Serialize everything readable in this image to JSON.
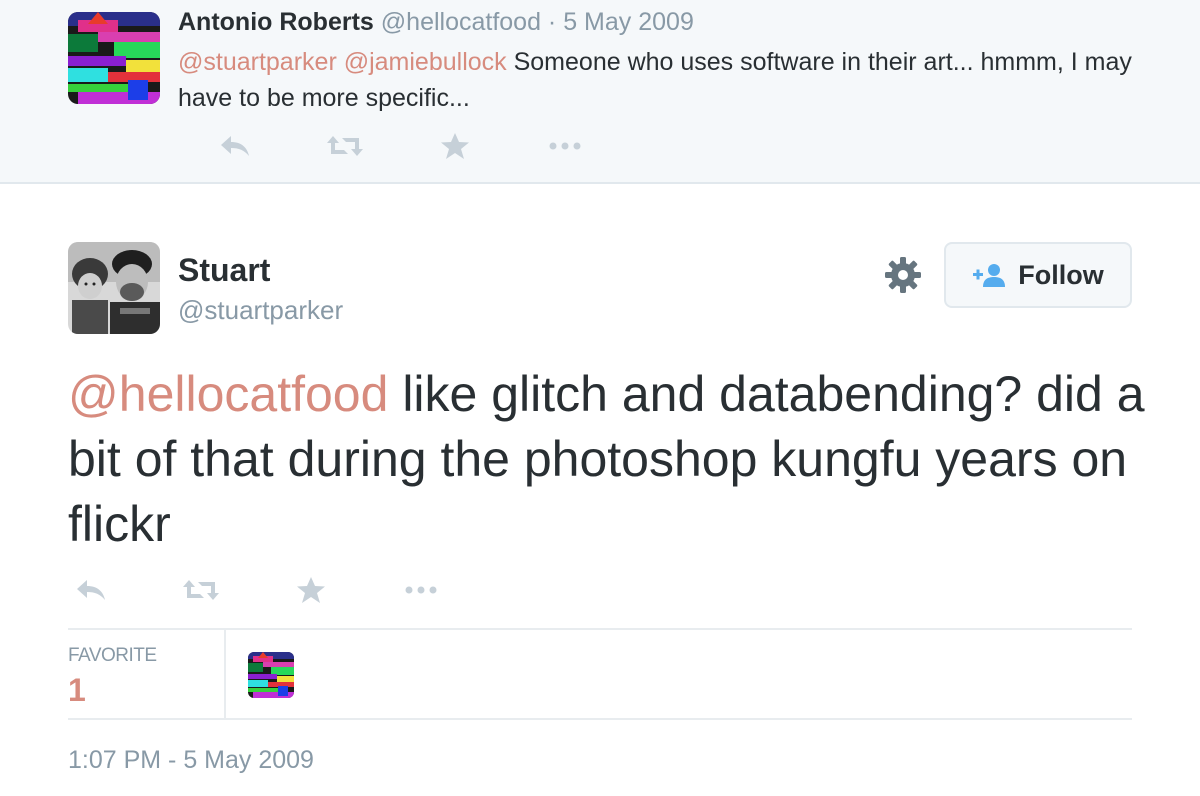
{
  "colors": {
    "mention": "#d78b7e",
    "muted": "#8899a6",
    "text": "#292f33",
    "parent_bg": "#f5f8fa"
  },
  "parent_tweet": {
    "name": "Antonio Roberts",
    "meta": "@hellocatfood · 5 May 2009",
    "mentions": "@stuartparker @jamiebullock",
    "text": " Someone who uses software in their art... hmmm, I may have to be more specific...",
    "actions": [
      "reply-icon",
      "retweet-icon",
      "favorite-icon",
      "more-icon"
    ]
  },
  "main_tweet": {
    "name": "Stuart",
    "handle": "@stuartparker",
    "follow_label": "Follow",
    "icons": [
      "gear-icon",
      "follow-person-icon"
    ],
    "mention": "@hellocatfood",
    "text": " like glitch and databending? did a bit of that during the photoshop kungfu years on flickr",
    "actions": [
      "reply-icon",
      "retweet-icon",
      "favorite-icon",
      "more-icon"
    ],
    "stats": {
      "favorite_label": "FAVORITE",
      "favorite_count": "1"
    },
    "timestamp": "1:07 PM - 5 May 2009"
  }
}
